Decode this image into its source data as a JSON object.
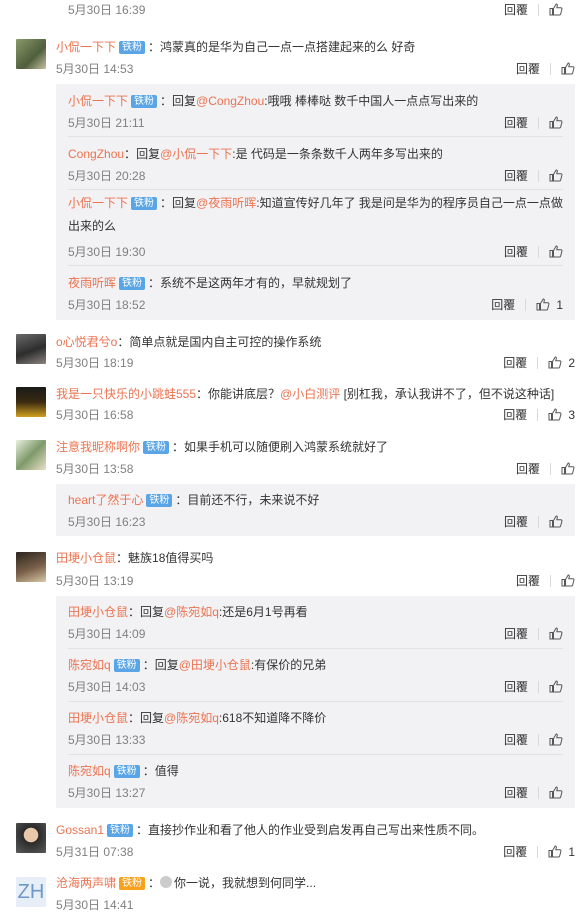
{
  "badge_iron": "铁粉",
  "badge_vip": "铁粉",
  "reply_label": "回覆",
  "reply_sep": "：",
  "reply_prefix": "回复",
  "comments": [
    {
      "time": "5月30日 16:39"
    },
    {
      "name": "小侃一下下",
      "text": "鸿蒙真的是华为自己一点一点搭建起来的么 好奇",
      "time": "5月30日 14:53",
      "replies": [
        {
          "name": "小侃一下下",
          "to": "@CongZhou",
          "text": ":哦哦 棒棒哒 数千中国人一点点写出来的",
          "time": "5月30日 21:11"
        },
        {
          "name": "CongZhou",
          "to": "@小侃一下下",
          "text": ":是 代码是一条条数千人两年多写出来的",
          "time": "5月30日 20:28"
        },
        {
          "name": "小侃一下下",
          "to": "@夜雨听晖",
          "text": ":知道宣传好几年了 我是问是华为的程序员自己一点一点做出来的么",
          "time": "5月30日 19:30"
        },
        {
          "name": "夜雨听晖",
          "text": "系统不是这两年才有的，早就规划了",
          "time": "5月30日 18:52",
          "likes": "1"
        }
      ]
    },
    {
      "name": "o心悦君兮o",
      "text": "简单点就是国内自主可控的操作系统",
      "time": "5月30日 18:19",
      "likes": "2"
    },
    {
      "name": "我是一只快乐的小跳蛙555",
      "text": "你能讲底层？",
      "mention": "@小白测评",
      "text2": " [别杠我，承认我讲不了，但不说这种话]",
      "time": "5月30日 16:58",
      "likes": "3"
    },
    {
      "name": "注意我昵称啊你",
      "text": "如果手机可以随便刷入鸿蒙系统就好了",
      "time": "5月30日 13:58",
      "replies": [
        {
          "name": "heart了然于心",
          "text": "目前还不行，未来说不好",
          "time": "5月30日 16:23"
        }
      ]
    },
    {
      "name": "田埂小仓鼠",
      "text": "魅族18值得买吗",
      "time": "5月30日 13:19",
      "replies": [
        {
          "name": "田埂小仓鼠",
          "to": "@陈宛如q",
          "text": ":还是6月1号再看",
          "time": "5月30日 14:09"
        },
        {
          "name": "陈宛如q",
          "to": "@田埂小仓鼠",
          "text": ":有保价的兄弟",
          "time": "5月30日 14:03"
        },
        {
          "name": "田埂小仓鼠",
          "to": "@陈宛如q",
          "text": ":618不知道降不降价",
          "time": "5月30日 13:33"
        },
        {
          "name": "陈宛如q",
          "text": "值得",
          "time": "5月30日 13:27"
        }
      ]
    },
    {
      "name": "Gossan1",
      "text": "直接抄作业和看了他人的作业受到启发再自己写出来性质不同。",
      "time": "5月31日 07:38",
      "likes": "1"
    },
    {
      "name": "沧海两声啸",
      "text": "你一说，我就想到何同学...",
      "time": "5月30日 14:41",
      "avatar_text": "ZH"
    }
  ],
  "colors": {
    "accent": "#eb7350",
    "badge": "#5aa5e6",
    "subbg": "#f2f2f5"
  }
}
